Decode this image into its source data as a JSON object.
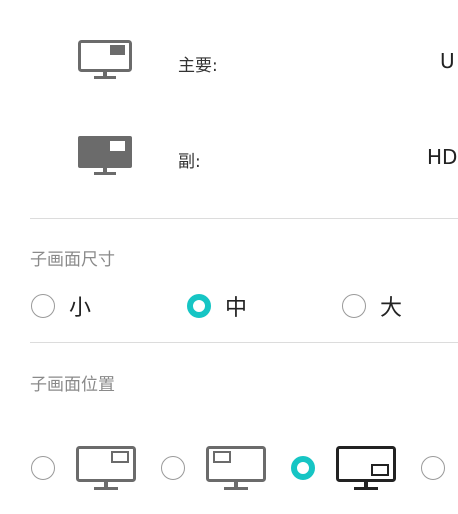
{
  "sources": {
    "main": {
      "label": "主要:",
      "value": "U",
      "icon": "monitor-pip-icon"
    },
    "sub": {
      "label": "副:",
      "value": "HD",
      "icon": "monitor-filled-icon"
    }
  },
  "pip_size": {
    "title": "子画面尺寸",
    "options": [
      {
        "label": "小",
        "selected": false
      },
      {
        "label": "中",
        "selected": true
      },
      {
        "label": "大",
        "selected": false
      }
    ]
  },
  "pip_position": {
    "title": "子画面位置",
    "options": [
      {
        "icon": "monitor-pip-top-right-icon",
        "selected": false
      },
      {
        "icon": "monitor-pip-top-left-icon",
        "selected": false
      },
      {
        "icon": "monitor-pip-bottom-right-icon",
        "selected": true
      },
      {
        "icon": "monitor-pip-bottom-left-icon",
        "selected": false
      }
    ]
  },
  "colors": {
    "accent": "#16c5c4",
    "divider": "#dcdcdc",
    "icon_gray": "#6b6b6b",
    "icon_selected": "#222222"
  }
}
